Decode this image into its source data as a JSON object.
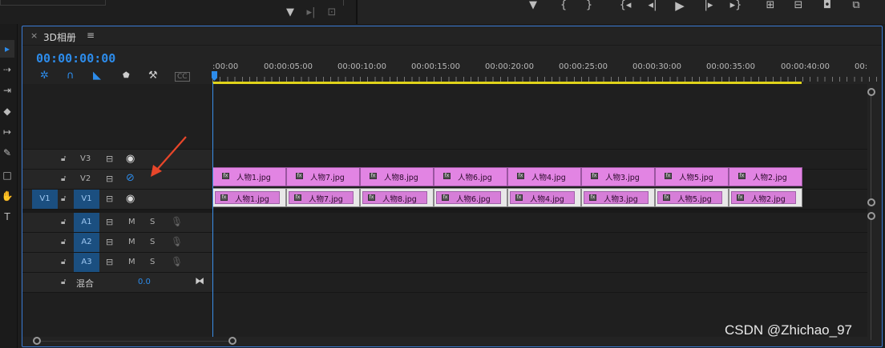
{
  "sequence_tab": {
    "close": "×",
    "title": "3D相册",
    "menu": "≡"
  },
  "timecode": "00:00:00:00",
  "ruler": {
    "labels": [
      ":00:00",
      "00:00:05:00",
      "00:00:10:00",
      "00:00:15:00",
      "00:00:20:00",
      "00:00:25:00",
      "00:00:30:00",
      "00:00:35:00",
      "00:00:40:00",
      "00:"
    ]
  },
  "tracks": {
    "v3": {
      "label": "V3"
    },
    "v2": {
      "label": "V2"
    },
    "v1": {
      "source": "V1",
      "label": "V1"
    },
    "a1": {
      "label": "A1",
      "m": "M",
      "s": "S"
    },
    "a2": {
      "label": "A2",
      "m": "M",
      "s": "S"
    },
    "a3": {
      "label": "A3",
      "m": "M",
      "s": "S"
    },
    "mix": {
      "label": "混合",
      "value": "0.0"
    }
  },
  "clips_v2": [
    "人物1.jpg",
    "人物7.jpg",
    "人物8.jpg",
    "人物6.jpg",
    "人物4.jpg",
    "人物3.jpg",
    "人物5.jpg",
    "人物2.jpg"
  ],
  "clips_v1": [
    "人物1.jpg",
    "人物7.jpg",
    "人物8.jpg",
    "人物6.jpg",
    "人物4.jpg",
    "人物3.jpg",
    "人物5.jpg",
    "人物2.jpg"
  ],
  "fx_badge": "fx",
  "watermark": "CSDN @Zhichao_97",
  "colors": {
    "accent": "#2d8ceb",
    "clip": "#e284e3",
    "work_area": "#e0d31a",
    "target_on": "#1b4f80",
    "annotation_arrow": "#e8462a"
  },
  "icons": {
    "top_toolbar": [
      "filter-icon",
      "insert-icon",
      "export-frame-icon",
      "marker-icon",
      "mark-in-icon",
      "mark-out-icon",
      "go-to-in-icon",
      "step-back-icon",
      "play-icon",
      "step-forward-icon",
      "go-to-out-icon",
      "lift-icon",
      "extract-icon",
      "camera-icon",
      "compare-icon"
    ],
    "timeline_header": [
      "snap-icon",
      "linked-selection-icon",
      "add-marker-icon",
      "marker-icon",
      "settings-wrench-icon",
      "captions-icon"
    ]
  }
}
